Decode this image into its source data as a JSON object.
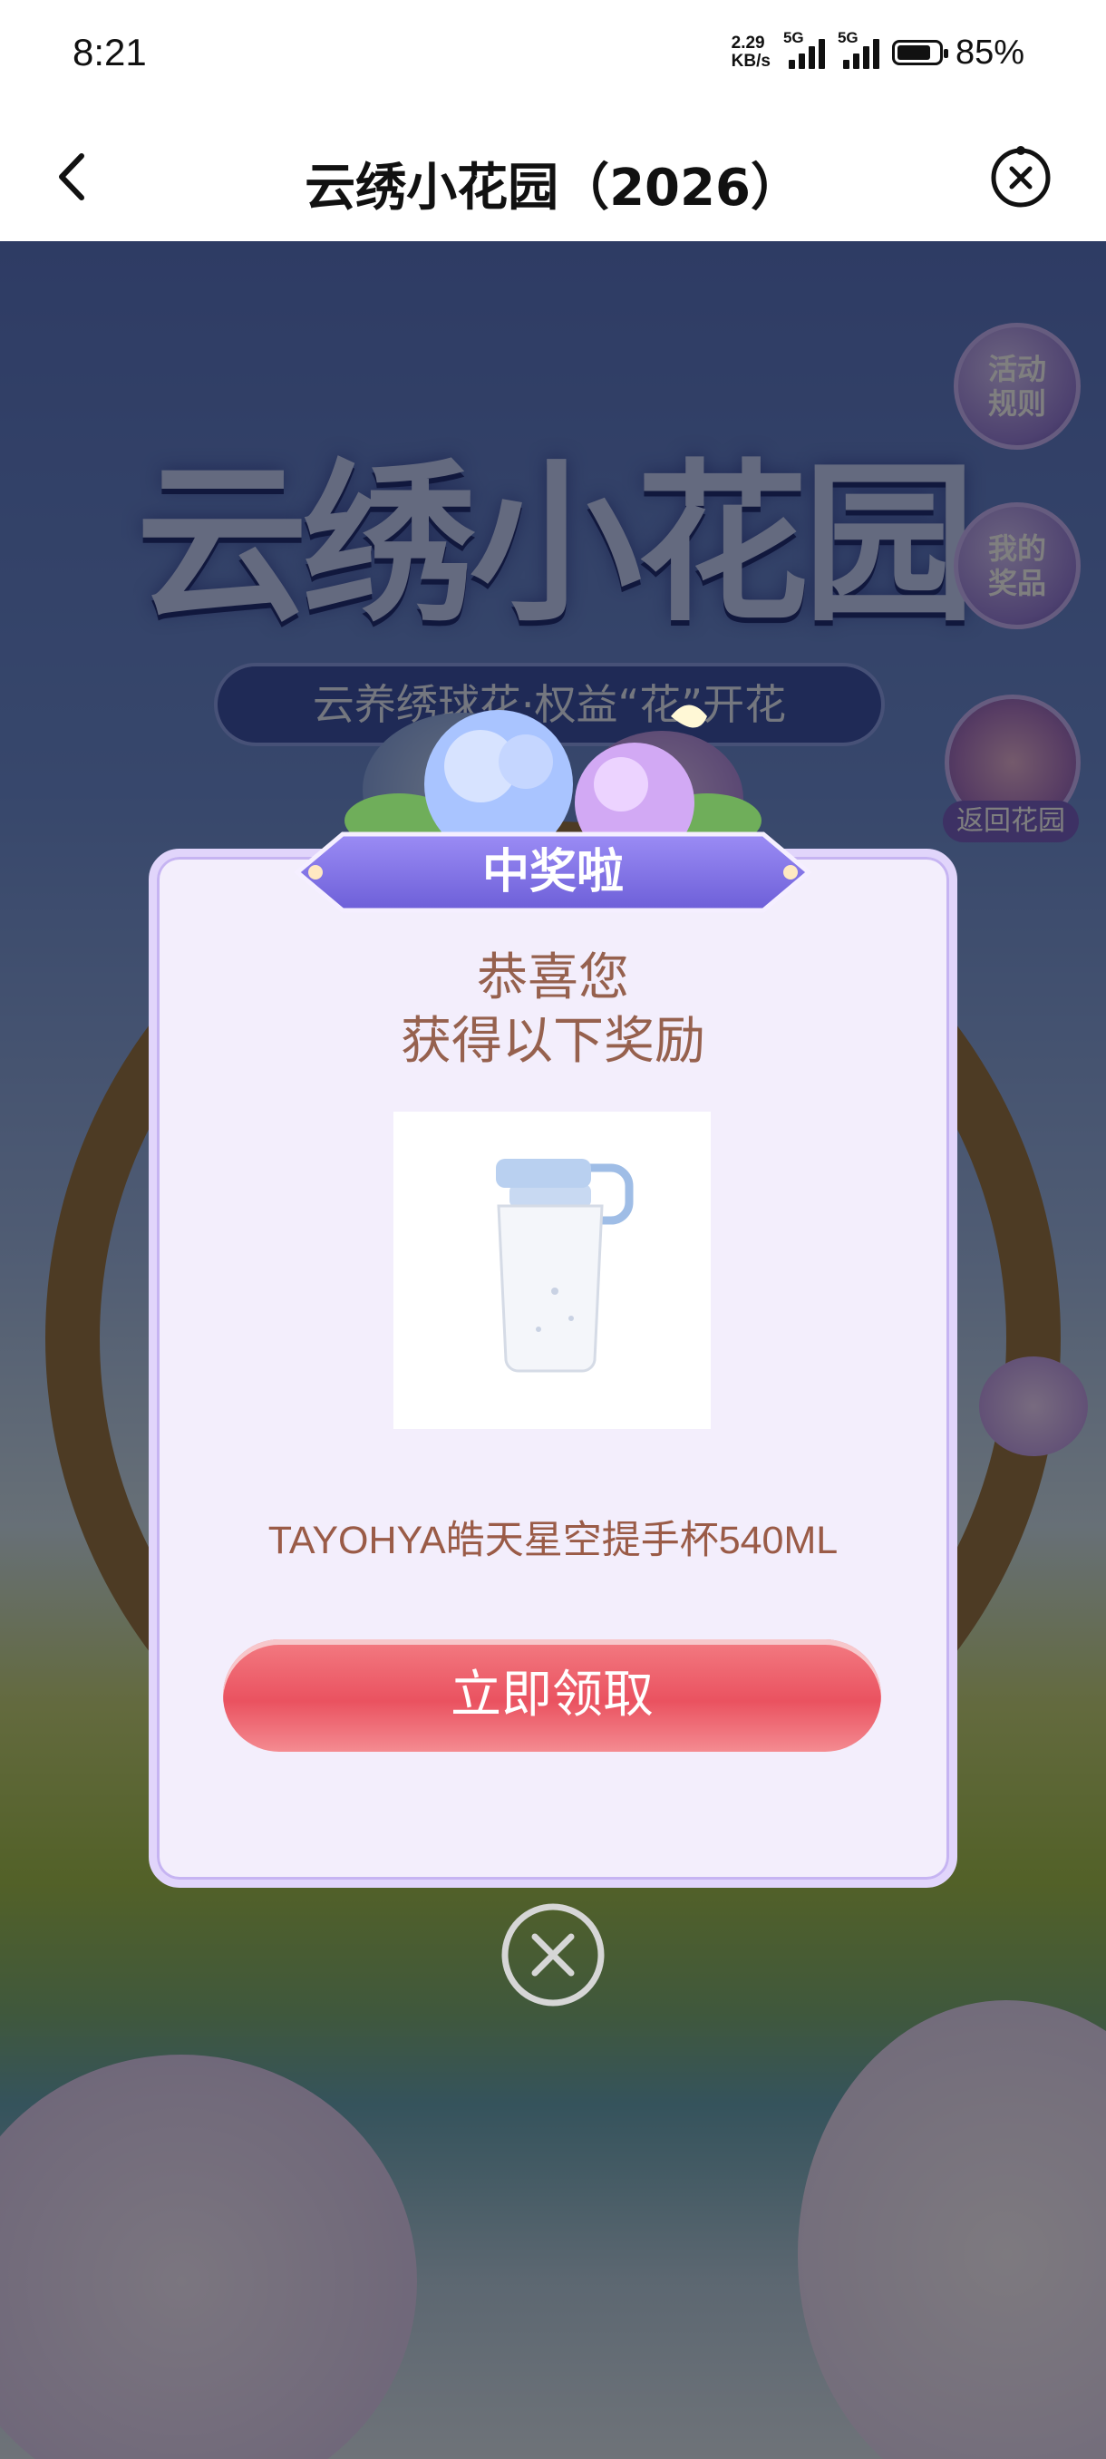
{
  "status_bar": {
    "time": "8:21",
    "speed_value": "2.29",
    "speed_unit": "KB/s",
    "sim1_label": "5G",
    "sim2_label": "5G",
    "battery_percent": "85%",
    "battery_level": 0.85
  },
  "nav": {
    "title": "云绣小花园（2026）",
    "back_icon": "chevron-left-icon",
    "close_icon": "close-circle-icon"
  },
  "background": {
    "title": "云绣小花园",
    "subtitle": "云养绣球花·权益“花”开花",
    "side_buttons": [
      {
        "label": "活动\n规则"
      },
      {
        "label": "我的\n奖品"
      },
      {
        "label": "返回花园"
      }
    ]
  },
  "modal": {
    "header": "中奖啦",
    "congrats_line1": "恭喜您",
    "congrats_line2": "获得以下奖励",
    "prize_name": "TAYOHYA皓天星空提手杯540ML",
    "claim_label": "立即领取",
    "close_icon": "close-circle-icon",
    "colors": {
      "accent": "#7b6fe0",
      "button": "#ea5260",
      "text": "#96614e"
    }
  }
}
